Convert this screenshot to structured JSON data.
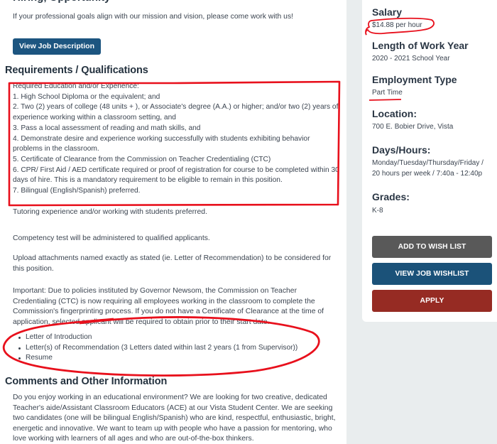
{
  "main": {
    "cut_heading": "Hiring, Opportunity",
    "intro_text": "If your professional goals align with our mission and vision, please come work with us!",
    "view_job_description_label": "View Job Description",
    "requirements": {
      "heading": "Requirements / Qualifications",
      "lines": [
        "Required Education and/or Experience:",
        "1.  High School Diploma or the equivalent; and",
        "2.  Two (2) years of college (48 units + ), or Associate's degree (A.A.) or higher; and/or two (2) years of experience working within a classroom setting, and",
        "3.  Pass a local assessment of reading and math skills, and",
        "4.  Demonstrate desire and experience working successfully with students exhibiting behavior problems in the classroom.",
        "5.  Certificate of Clearance from the Commission on Teacher Credentialing (CTC)",
        "6.  CPR/ First Aid / AED certificate required or proof of registration for course to be completed within 30 days of hire. This is a mandatory requirement to be eligible to remain in this position.",
        "7.  Bilingual (English/Spanish) preferred."
      ],
      "tutoring_note": "Tutoring experience and/or working with students preferred.",
      "competency_note": "Competency test will be administered to qualified applicants.",
      "upload_note": "Upload attachments named exactly as stated (ie. Letter of Recommendation) to be considered for this position.",
      "important_note": "Important: Due to policies instituted by Governor Newsom, the Commission on Teacher Credentialing (CTC) is now requiring all employees working in the classroom to complete the Commission's fingerprinting process. If you do not have a Certificate of Clearance at the time of application, selected applicant will be required to obtain prior to their start date.",
      "attachments": [
        "Letter of Introduction",
        "Letter(s) of Recommendation (3 Letters dated within last 2 years (1 from Supervisor))",
        "Resume"
      ]
    },
    "comments": {
      "heading": "Comments and Other Information",
      "text": "Do you enjoy working in an educational environment?  We are looking for two creative, dedicated Teacher's aide/Assistant Classroom Educators (ACE) at our Vista Student Center.  We are seeking two candidates (one will be bilingual English/Spanish) who are kind, respectful, enthusiastic, bright, energetic and innovative. We want to team up with people who have a passion for mentoring, who love working with learners of all ages and who are out-of-the-box thinkers."
    }
  },
  "sidebar": {
    "salary_label": "Salary",
    "salary_value": "$14.88 per hour",
    "length_label": "Length of Work Year",
    "length_value": "2020 - 2021 School Year",
    "employment_label": "Employment Type",
    "employment_value": "Part Time",
    "location_label": "Location:",
    "location_value": "700 E. Bobier Drive, Vista",
    "days_label": "Days/Hours:",
    "days_value": "Monday/Tuesday/Thursday/Friday / 20 hours per week / 7:40a - 12:40p",
    "grades_label": "Grades:",
    "grades_value": "K-8",
    "add_wishlist_label": "ADD TO WISH LIST",
    "view_wishlist_label": "VIEW JOB WISHLIST",
    "apply_label": "APPLY"
  },
  "colors": {
    "primary_blue": "#1c5580",
    "gray_button": "#595959",
    "apply_red": "#962b23",
    "annotation_red": "#e8101c",
    "sidebar_bg": "#e9edee"
  }
}
